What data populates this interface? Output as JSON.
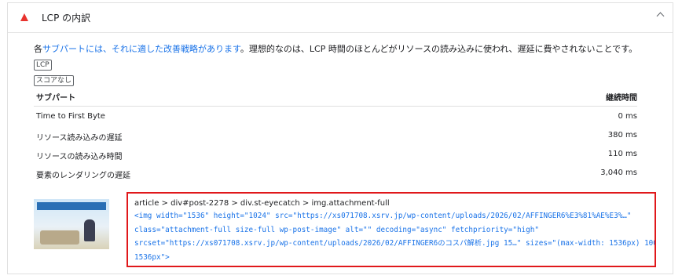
{
  "header": {
    "title": "LCP の内訳",
    "warn_icon": "warning-triangle-icon",
    "toggle_icon": "chevron-up-icon",
    "warn_color": "#e8332e"
  },
  "description": {
    "lead": "各",
    "link_text": "サブパートには、それに適した改善戦略があります",
    "rest": "。理想的なのは、LCP 時間のほとんどがリソースの読み込みに使われ、遅延に費やされないことです。",
    "tag_lcp": "LCP",
    "tag_score": "スコアなし"
  },
  "table": {
    "col_subpart": "サブパート",
    "col_duration": "継続時間",
    "rows": [
      {
        "label": "Time to First Byte",
        "value": "0 ms"
      },
      {
        "label": "リソース読み込みの遅延",
        "value": "380 ms"
      },
      {
        "label": "リソースの読み込み時間",
        "value": "110 ms"
      },
      {
        "label": "要素のレンダリングの遅延",
        "value": "3,040 ms"
      }
    ]
  },
  "node": {
    "path": "article > div#post-2278 > div.st-eyecatch > img.attachment-full",
    "lines": [
      "<img width=\"1536\" height=\"1024\" src=\"https://xs071708.xsrv.jp/wp-content/uploads/2026/02/AFFINGER6%E3%81%AE%E3%…\"",
      "class=\"attachment-full size-full wp-post-image\" alt=\"\" decoding=\"async\" fetchpriority=\"high\"",
      "srcset=\"https://xs071708.xsrv.jp/wp-content/uploads/2026/02/AFFINGER6のコスパ解析.jpg 15…\" sizes=\"(max-width: 1536px) 100vw,",
      "1536px\">"
    ],
    "highlight_color": "#e0181b"
  }
}
